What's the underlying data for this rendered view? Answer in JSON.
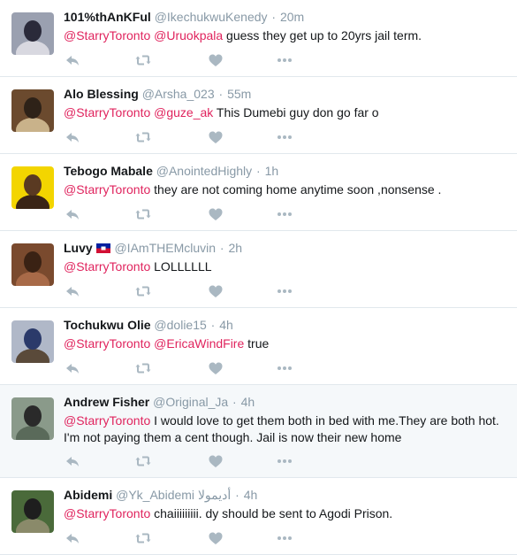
{
  "tweets": [
    {
      "fullname": "101%thAnKFul",
      "username": "@IkechukwuKenedy",
      "time": "20m",
      "segments": [
        {
          "t": "@StarryToronto",
          "m": true
        },
        {
          "t": " ",
          "m": false
        },
        {
          "t": "@Uruokpala",
          "m": true
        },
        {
          "t": " guess they get up to 20yrs jail term.",
          "m": false
        }
      ],
      "avatar_colors": [
        "#9aa0b0",
        "#2a2a3a",
        "#d8d8e0"
      ]
    },
    {
      "fullname": "Alo Blessing",
      "username": "@Arsha_023",
      "time": "55m",
      "segments": [
        {
          "t": "@StarryToronto",
          "m": true
        },
        {
          "t": " ",
          "m": false
        },
        {
          "t": "@guze_ak",
          "m": true
        },
        {
          "t": " This Dumebi guy don go far o",
          "m": false
        }
      ],
      "avatar_colors": [
        "#6b4a2e",
        "#2e2218",
        "#c9b28a"
      ]
    },
    {
      "fullname": "Tebogo Mabale",
      "username": "@AnointedHighly",
      "time": "1h",
      "segments": [
        {
          "t": "@StarryToronto",
          "m": true
        },
        {
          "t": " they are not coming home anytime soon ,nonsense .",
          "m": false
        }
      ],
      "avatar_colors": [
        "#f3d500",
        "#5a3a22",
        "#3a2416"
      ]
    },
    {
      "fullname": "Luvy",
      "flag": "haiti-flag-icon",
      "username": "@IAmTHEMcluvin",
      "time": "2h",
      "segments": [
        {
          "t": "@StarryToronto",
          "m": true
        },
        {
          "t": " LOLLLLLL",
          "m": false
        }
      ],
      "avatar_colors": [
        "#7a4a2e",
        "#3a2214",
        "#a86a48"
      ]
    },
    {
      "fullname": "Tochukwu Olie",
      "username": "@dolie15",
      "time": "4h",
      "segments": [
        {
          "t": "@StarryToronto",
          "m": true
        },
        {
          "t": " ",
          "m": false
        },
        {
          "t": "@EricaWindFire",
          "m": true
        },
        {
          "t": " true",
          "m": false
        }
      ],
      "avatar_colors": [
        "#b0b8c8",
        "#2b3a6a",
        "#5a4a3a"
      ]
    },
    {
      "fullname": "Andrew Fisher",
      "username": "@Original_Ja",
      "time": "4h",
      "highlighted": true,
      "segments": [
        {
          "t": "@StarryToronto",
          "m": true
        },
        {
          "t": " I would love to get them both in bed with me.They are both hot. I'm not paying them a cent though. Jail is now their new home",
          "m": false
        }
      ],
      "avatar_colors": [
        "#8a9a8a",
        "#2a2a2a",
        "#5a6a5a"
      ]
    },
    {
      "fullname": "Abidemi",
      "username": "@Yk_Abidemi",
      "display_suffix": "أديمولا",
      "time": "4h",
      "segments": [
        {
          "t": "@StarryToronto",
          "m": true
        },
        {
          "t": " chaiiiiiiiii. dy should be sent to Agodi Prison.",
          "m": false
        }
      ],
      "avatar_colors": [
        "#4a6a3a",
        "#1e1e1e",
        "#8a8a6a"
      ]
    }
  ],
  "actions": [
    "reply-icon",
    "retweet-icon",
    "like-icon",
    "more-icon"
  ],
  "colors": {
    "mention": "#e0245e",
    "muted": "#8899a6",
    "icon": "#aab8c2",
    "highlight_bg": "#f5f8fa",
    "divider": "#e1e8ed"
  }
}
